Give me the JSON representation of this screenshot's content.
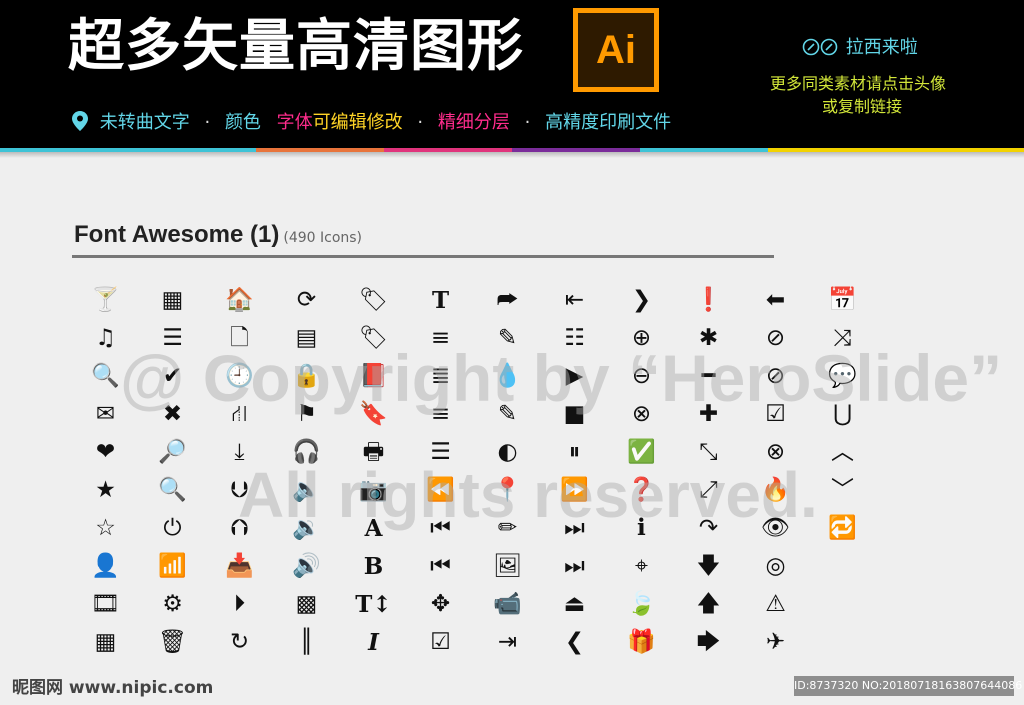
{
  "banner": {
    "title": "超多矢量高清图形",
    "logo_text": "Ai",
    "tagline": {
      "part1": "未转曲文字",
      "part2": "颜色",
      "part3": "字体",
      "part4": "可编辑修改",
      "part5": "精细分层",
      "part6": "高精度印刷文件",
      "separator": "·"
    },
    "promo_title": "拉西来啦",
    "promo_line1": "更多同类素材请点击头像",
    "promo_line2": "或复制链接"
  },
  "colors": {
    "cyan": "#62d6e8",
    "pink": "#ff2c8c",
    "yellow": "#ffd426",
    "orange_logo": "#ff9a00",
    "stripe": [
      "#3ec3d6",
      "#3ec3d6",
      "#e8743b",
      "#e0347c",
      "#7a2c9a",
      "#3ec3d6",
      "#f2d200",
      "#f2d200"
    ]
  },
  "section": {
    "heading": "Font Awesome (1)",
    "count": "(490 Icons)"
  },
  "icons": [
    {
      "name": "glass",
      "g": "🍸"
    },
    {
      "name": "th",
      "g": "▦"
    },
    {
      "name": "home",
      "g": "🏠"
    },
    {
      "name": "refresh",
      "g": "⟳"
    },
    {
      "name": "tag",
      "g": "🏷"
    },
    {
      "name": "text-height",
      "g": "T"
    },
    {
      "name": "share-square",
      "g": "⮫"
    },
    {
      "name": "outdent",
      "g": "⇤"
    },
    {
      "name": "chevron-right",
      "g": "❯"
    },
    {
      "name": "exclamation-circle",
      "g": "❗"
    },
    {
      "name": "arrow-left",
      "g": "⬅"
    },
    {
      "name": "calendar",
      "g": "📅"
    },
    {
      "name": "music",
      "g": "♫"
    },
    {
      "name": "th-list",
      "g": "☰"
    },
    {
      "name": "file-o",
      "g": "🗋"
    },
    {
      "name": "list-alt",
      "g": "▤"
    },
    {
      "name": "tags",
      "g": "🏷"
    },
    {
      "name": "align-left",
      "g": "≡"
    },
    {
      "name": "edit",
      "g": "✎"
    },
    {
      "name": "list",
      "g": "☷"
    },
    {
      "name": "plus-circle",
      "g": "⊕"
    },
    {
      "name": "asterisk",
      "g": "✱"
    },
    {
      "name": "ban",
      "g": "⊘"
    },
    {
      "name": "random",
      "g": "⤨"
    },
    {
      "name": "search",
      "g": "🔍"
    },
    {
      "name": "check",
      "g": "✔"
    },
    {
      "name": "clock",
      "g": "🕘"
    },
    {
      "name": "lock",
      "g": "🔒"
    },
    {
      "name": "book",
      "g": "📕"
    },
    {
      "name": "align-center",
      "g": "≣"
    },
    {
      "name": "tint",
      "g": "💧"
    },
    {
      "name": "play",
      "g": "▶"
    },
    {
      "name": "minus-circle",
      "g": "⊖"
    },
    {
      "name": "minus",
      "g": "━"
    },
    {
      "name": "ban-2",
      "g": "⊘"
    },
    {
      "name": "comment",
      "g": "💬"
    },
    {
      "name": "envelope",
      "g": "✉"
    },
    {
      "name": "times",
      "g": "✖"
    },
    {
      "name": "road",
      "g": "⛙"
    },
    {
      "name": "flag",
      "g": "⚑"
    },
    {
      "name": "bookmark",
      "g": "🔖"
    },
    {
      "name": "align-right",
      "g": "≡"
    },
    {
      "name": "pencil-square",
      "g": "✎"
    },
    {
      "name": "stop",
      "g": "■"
    },
    {
      "name": "times-circle",
      "g": "⊗"
    },
    {
      "name": "plus",
      "g": "✚"
    },
    {
      "name": "check-circle-o",
      "g": "☑"
    },
    {
      "name": "magnet",
      "g": "⋃"
    },
    {
      "name": "heart",
      "g": "❤"
    },
    {
      "name": "search-plus",
      "g": "🔎"
    },
    {
      "name": "download",
      "g": "⤓"
    },
    {
      "name": "headphones",
      "g": "🎧"
    },
    {
      "name": "print",
      "g": "🖶"
    },
    {
      "name": "align-justify",
      "g": "☰"
    },
    {
      "name": "adjust",
      "g": "◐"
    },
    {
      "name": "pause",
      "g": "⏸"
    },
    {
      "name": "check-circle",
      "g": "✅"
    },
    {
      "name": "compress",
      "g": "⤡"
    },
    {
      "name": "times-circle-o",
      "g": "⊗"
    },
    {
      "name": "chevron-up",
      "g": "︿"
    },
    {
      "name": "star",
      "g": "★"
    },
    {
      "name": "search-minus",
      "g": "🔍"
    },
    {
      "name": "arrow-circle-down",
      "g": "⮋"
    },
    {
      "name": "volume-off",
      "g": "🔈"
    },
    {
      "name": "camera",
      "g": "📷"
    },
    {
      "name": "backward",
      "g": "⏪"
    },
    {
      "name": "map-marker",
      "g": "📍"
    },
    {
      "name": "forward",
      "g": "⏩"
    },
    {
      "name": "question-circle",
      "g": "❓"
    },
    {
      "name": "expand",
      "g": "⤢"
    },
    {
      "name": "fire",
      "g": "🔥"
    },
    {
      "name": "chevron-down",
      "g": "﹀"
    },
    {
      "name": "star-o",
      "g": "☆"
    },
    {
      "name": "power-off",
      "g": "⏻"
    },
    {
      "name": "arrow-circle-up",
      "g": "⮉"
    },
    {
      "name": "volume-down",
      "g": "🔉"
    },
    {
      "name": "font",
      "g": "A"
    },
    {
      "name": "fast-backward",
      "g": "⏮"
    },
    {
      "name": "pencil",
      "g": "✏"
    },
    {
      "name": "fast-forward",
      "g": "⏭"
    },
    {
      "name": "info-circle",
      "g": "ℹ"
    },
    {
      "name": "share",
      "g": "↷"
    },
    {
      "name": "eye",
      "g": "👁"
    },
    {
      "name": "retweet",
      "g": "🔁"
    },
    {
      "name": "user",
      "g": "👤"
    },
    {
      "name": "signal",
      "g": "📶"
    },
    {
      "name": "inbox",
      "g": "📥"
    },
    {
      "name": "volume-up",
      "g": "🔊"
    },
    {
      "name": "bold",
      "g": "B"
    },
    {
      "name": "step-backward",
      "g": "⏮"
    },
    {
      "name": "picture",
      "g": "🖼"
    },
    {
      "name": "step-forward",
      "g": "⏭"
    },
    {
      "name": "crosshairs",
      "g": "⌖"
    },
    {
      "name": "arrow-down",
      "g": "🡇"
    },
    {
      "name": "eye-slash",
      "g": "◎"
    },
    {
      "name": "blank-1",
      "g": ""
    },
    {
      "name": "film",
      "g": "🎞"
    },
    {
      "name": "cog",
      "g": "⚙"
    },
    {
      "name": "play-circle",
      "g": "⏵"
    },
    {
      "name": "qrcode",
      "g": "▩"
    },
    {
      "name": "text-width",
      "g": "T↕"
    },
    {
      "name": "arrows",
      "g": "✥"
    },
    {
      "name": "video-camera",
      "g": "📹"
    },
    {
      "name": "eject",
      "g": "⏏"
    },
    {
      "name": "leaf",
      "g": "🍃"
    },
    {
      "name": "arrow-up",
      "g": "🡅"
    },
    {
      "name": "warning",
      "g": "⚠"
    },
    {
      "name": "blank-2",
      "g": ""
    },
    {
      "name": "th-large",
      "g": "▦"
    },
    {
      "name": "trash",
      "g": "🗑"
    },
    {
      "name": "repeat",
      "g": "↻"
    },
    {
      "name": "barcode",
      "g": "║"
    },
    {
      "name": "italic",
      "g": "I"
    },
    {
      "name": "check-square",
      "g": "☑"
    },
    {
      "name": "indent",
      "g": "⇥"
    },
    {
      "name": "chevron-left",
      "g": "❮"
    },
    {
      "name": "gift",
      "g": "🎁"
    },
    {
      "name": "arrow-right",
      "g": "🡆"
    },
    {
      "name": "plane",
      "g": "✈"
    },
    {
      "name": "blank-3",
      "g": ""
    }
  ],
  "watermark": {
    "line1": "@ Copyright by “HeroSlide”",
    "line2": "All rights reserved."
  },
  "footer": {
    "site": "昵图网 www.nipic.com",
    "id_text": "ID:8737320 NO:20180718163807644086"
  }
}
